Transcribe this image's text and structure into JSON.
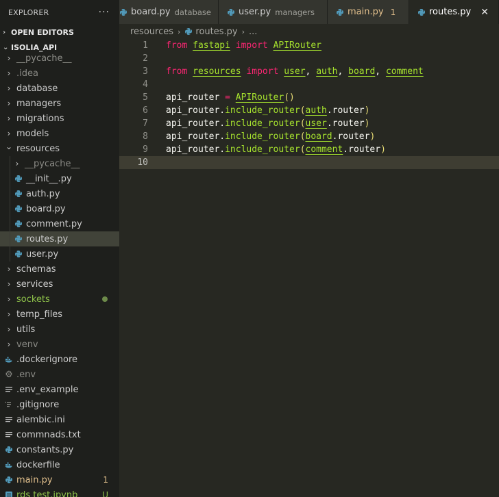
{
  "sidebar": {
    "title": "EXPLORER",
    "open_editors": "OPEN EDITORS",
    "project": "ISOLIA_API",
    "items": [
      {
        "label": "__pycache__",
        "kind": "folder",
        "cls": "dim",
        "depth": 0
      },
      {
        "label": ".idea",
        "kind": "folder",
        "cls": "dim",
        "depth": 0
      },
      {
        "label": "database",
        "kind": "folder",
        "cls": "",
        "depth": 0
      },
      {
        "label": "managers",
        "kind": "folder",
        "cls": "",
        "depth": 0
      },
      {
        "label": "migrations",
        "kind": "folder",
        "cls": "",
        "depth": 0
      },
      {
        "label": "models",
        "kind": "folder",
        "cls": "",
        "depth": 0
      },
      {
        "label": "resources",
        "kind": "folder-open",
        "cls": "",
        "depth": 0
      },
      {
        "label": "__pycache__",
        "kind": "folder",
        "cls": "dim",
        "depth": 1
      },
      {
        "label": "__init__.py",
        "kind": "python",
        "cls": "",
        "depth": 1
      },
      {
        "label": "auth.py",
        "kind": "python",
        "cls": "",
        "depth": 1
      },
      {
        "label": "board.py",
        "kind": "python",
        "cls": "",
        "depth": 1
      },
      {
        "label": "comment.py",
        "kind": "python",
        "cls": "",
        "depth": 1
      },
      {
        "label": "routes.py",
        "kind": "python",
        "cls": "",
        "depth": 1,
        "selected": true
      },
      {
        "label": "user.py",
        "kind": "python",
        "cls": "",
        "depth": 1
      },
      {
        "label": "schemas",
        "kind": "folder",
        "cls": "",
        "depth": 0
      },
      {
        "label": "services",
        "kind": "folder",
        "cls": "",
        "depth": 0
      },
      {
        "label": "sockets",
        "kind": "folder",
        "cls": "green",
        "depth": 0,
        "dot": true
      },
      {
        "label": "temp_files",
        "kind": "folder",
        "cls": "",
        "depth": 0
      },
      {
        "label": "utils",
        "kind": "folder",
        "cls": "",
        "depth": 0
      },
      {
        "label": "venv",
        "kind": "folder",
        "cls": "dim",
        "depth": 0
      },
      {
        "label": ".dockerignore",
        "kind": "docker",
        "cls": "",
        "depth": -1
      },
      {
        "label": ".env",
        "kind": "gear",
        "cls": "dim",
        "depth": -1
      },
      {
        "label": ".env_example",
        "kind": "lines",
        "cls": "",
        "depth": -1
      },
      {
        "label": ".gitignore",
        "kind": "git",
        "cls": "",
        "depth": -1
      },
      {
        "label": "alembic.ini",
        "kind": "lines",
        "cls": "",
        "depth": -1
      },
      {
        "label": "commnads.txt",
        "kind": "lines",
        "cls": "",
        "depth": -1
      },
      {
        "label": "constants.py",
        "kind": "python",
        "cls": "",
        "depth": -1
      },
      {
        "label": "dockerfile",
        "kind": "docker",
        "cls": "",
        "depth": -1
      },
      {
        "label": "main.py",
        "kind": "python",
        "cls": "yellow",
        "depth": -1,
        "badge": "1",
        "badge_color": "#e2c08d"
      },
      {
        "label": "rds test.ipynb",
        "kind": "jupyter",
        "cls": "green",
        "depth": -1,
        "badge": "U",
        "badge_color": "#8fc34a"
      }
    ]
  },
  "tabs": [
    {
      "label": "board.py",
      "desc": "database",
      "active": false
    },
    {
      "label": "user.py",
      "desc": "managers",
      "active": false
    },
    {
      "label": "main.py",
      "desc": "",
      "count": "1",
      "warn": true,
      "active": false
    },
    {
      "label": "routes.py",
      "desc": "",
      "active": true,
      "close": "✕"
    }
  ],
  "breadcrumb": {
    "folder": "resources",
    "file": "routes.py",
    "more": "..."
  },
  "editor": {
    "current_line": 10,
    "lines": [
      [
        {
          "t": "from",
          "c": "kw"
        },
        {
          "t": " "
        },
        {
          "t": "fastapi",
          "c": "mod"
        },
        {
          "t": " "
        },
        {
          "t": "import",
          "c": "kw"
        },
        {
          "t": " "
        },
        {
          "t": "APIRouter",
          "c": "mod"
        }
      ],
      [],
      [
        {
          "t": "from",
          "c": "kw"
        },
        {
          "t": " "
        },
        {
          "t": "resources",
          "c": "mod"
        },
        {
          "t": " "
        },
        {
          "t": "import",
          "c": "kw"
        },
        {
          "t": " "
        },
        {
          "t": "user",
          "c": "mod"
        },
        {
          "t": ", "
        },
        {
          "t": "auth",
          "c": "mod"
        },
        {
          "t": ", "
        },
        {
          "t": "board",
          "c": "mod"
        },
        {
          "t": ", "
        },
        {
          "t": "comment",
          "c": "mod"
        }
      ],
      [],
      [
        {
          "t": "api_router "
        },
        {
          "t": "=",
          "c": "op"
        },
        {
          "t": " "
        },
        {
          "t": "APIRouter",
          "c": "mod"
        },
        {
          "t": "()",
          "c": "paren"
        }
      ],
      [
        {
          "t": "api_router."
        },
        {
          "t": "include_router",
          "c": "fn"
        },
        {
          "t": "(",
          "c": "paren"
        },
        {
          "t": "auth",
          "c": "mod"
        },
        {
          "t": ".router"
        },
        {
          "t": ")",
          "c": "paren"
        }
      ],
      [
        {
          "t": "api_router."
        },
        {
          "t": "include_router",
          "c": "fn"
        },
        {
          "t": "(",
          "c": "paren"
        },
        {
          "t": "user",
          "c": "mod"
        },
        {
          "t": ".router"
        },
        {
          "t": ")",
          "c": "paren"
        }
      ],
      [
        {
          "t": "api_router."
        },
        {
          "t": "include_router",
          "c": "fn"
        },
        {
          "t": "(",
          "c": "paren"
        },
        {
          "t": "board",
          "c": "mod"
        },
        {
          "t": ".router"
        },
        {
          "t": ")",
          "c": "paren"
        }
      ],
      [
        {
          "t": "api_router."
        },
        {
          "t": "include_router",
          "c": "fn"
        },
        {
          "t": "(",
          "c": "paren"
        },
        {
          "t": "comment",
          "c": "mod"
        },
        {
          "t": ".router"
        },
        {
          "t": ")",
          "c": "paren"
        }
      ],
      []
    ]
  },
  "colors": {
    "python_icon": "#519aba",
    "docker_icon": "#519aba",
    "git_icon": "#8b8b86",
    "modified": "#e2c08d",
    "untracked": "#8fc34a"
  }
}
